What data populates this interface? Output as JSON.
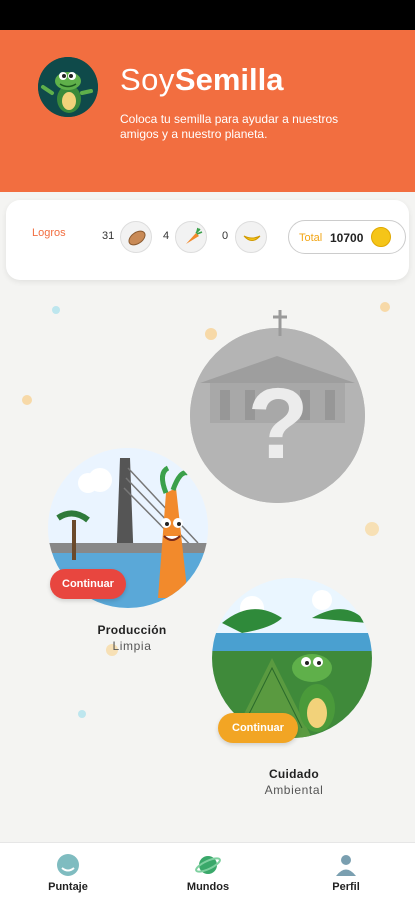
{
  "header": {
    "brand_soy": "Soy",
    "brand_semilla": "Semilla",
    "subtitle": "Coloca tu semilla para ayudar a nuestros amigos y a nuestro planeta.",
    "color": "#f26e40"
  },
  "stats": {
    "logros_label": "Logros",
    "items": [
      {
        "count": "31",
        "icon": "almond-seed-icon"
      },
      {
        "count": "4",
        "icon": "carrot-icon"
      },
      {
        "count": "0",
        "icon": "banana-icon"
      }
    ],
    "total_label": "Total",
    "total_value": "10700",
    "coin_icon": "coin-icon"
  },
  "worlds": [
    {
      "title": "Producción",
      "subtitle": "Limpia",
      "button": "Continuar",
      "button_color": "#e8463f"
    },
    {
      "title": "Cuidado",
      "subtitle": "Ambiental",
      "button": "Continuar",
      "button_color": "#f2a524"
    }
  ],
  "locked_world": {
    "icon": "question-mark-icon"
  },
  "nav": [
    {
      "label": "Puntaje",
      "icon": "score-icon"
    },
    {
      "label": "Mundos",
      "icon": "planet-icon"
    },
    {
      "label": "Perfil",
      "icon": "profile-icon"
    }
  ]
}
